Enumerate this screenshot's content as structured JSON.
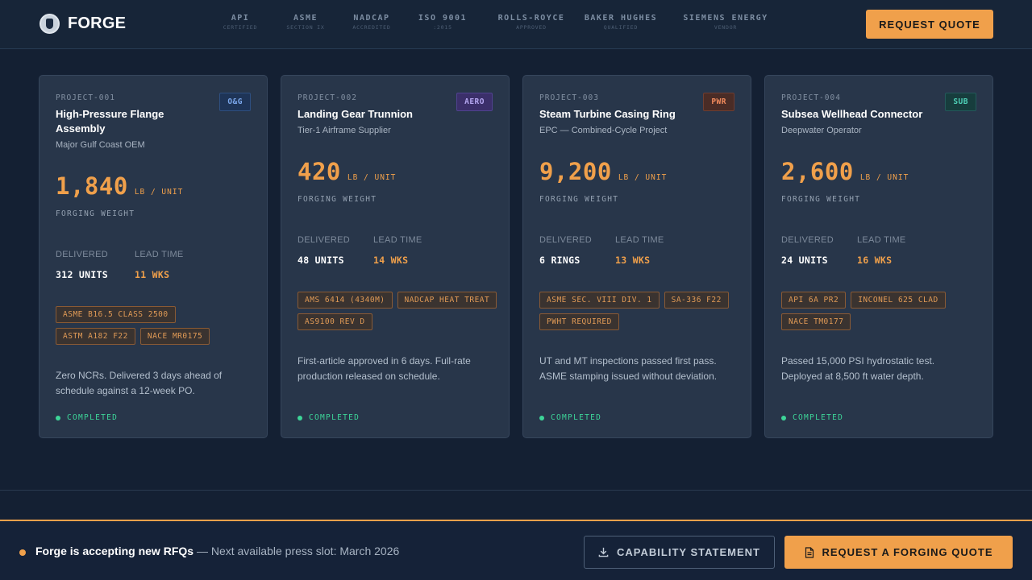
{
  "header": {
    "brand": "FORGE",
    "certifications": [
      {
        "name": "API",
        "sub": "CERTIFIED"
      },
      {
        "name": "ASME",
        "sub": "SECTION IX"
      },
      {
        "name": "NADCAP",
        "sub": "ACCREDITED"
      },
      {
        "name": "ISO 9001",
        "sub": ":2015"
      },
      {
        "name": "ROLLS-ROYCE",
        "sub": "APPROVED"
      },
      {
        "name": "BAKER HUGHES",
        "sub": "QUALIFIED"
      },
      {
        "name": "SIEMENS ENERGY",
        "sub": "VENDOR"
      }
    ],
    "quote_button": "REQUEST QUOTE"
  },
  "projects": [
    {
      "id": "PROJECT-001",
      "tag": "O&G",
      "title": "High-Pressure Flange Assembly",
      "client": "Major Gulf Coast OEM",
      "weight": "1,840",
      "weight_unit": "LB / UNIT",
      "weight_label": "FORGING WEIGHT",
      "delivered_label": "DELIVERED",
      "delivered": "312 UNITS",
      "lead_label": "LEAD TIME",
      "lead_time": "11 WKS",
      "specs": [
        "ASME B16.5 CLASS 2500",
        "ASTM A182 F22",
        "NACE MR0175"
      ],
      "note": "Zero NCRs. Delivered 3 days ahead of schedule against a 12-week PO.",
      "status": "COMPLETED"
    },
    {
      "id": "PROJECT-002",
      "tag": "AERO",
      "title": "Landing Gear Trunnion",
      "client": "Tier-1 Airframe Supplier",
      "weight": "420",
      "weight_unit": "LB / UNIT",
      "weight_label": "FORGING WEIGHT",
      "delivered_label": "DELIVERED",
      "delivered": "48 UNITS",
      "lead_label": "LEAD TIME",
      "lead_time": "14 WKS",
      "specs": [
        "AMS 6414 (4340M)",
        "NADCAP HEAT TREAT",
        "AS9100 REV D"
      ],
      "note": "First-article approved in 6 days. Full-rate production released on schedule.",
      "status": "COMPLETED"
    },
    {
      "id": "PROJECT-003",
      "tag": "PWR",
      "title": "Steam Turbine Casing Ring",
      "client": "EPC — Combined-Cycle Project",
      "weight": "9,200",
      "weight_unit": "LB / UNIT",
      "weight_label": "FORGING WEIGHT",
      "delivered_label": "DELIVERED",
      "delivered": "6 RINGS",
      "lead_label": "LEAD TIME",
      "lead_time": "13 WKS",
      "specs": [
        "ASME SEC. VIII DIV. 1",
        "SA-336 F22",
        "PWHT REQUIRED"
      ],
      "note": "UT and MT inspections passed first pass. ASME stamping issued without deviation.",
      "status": "COMPLETED"
    },
    {
      "id": "PROJECT-004",
      "tag": "SUB",
      "title": "Subsea Wellhead Connector",
      "client": "Deepwater Operator",
      "weight": "2,600",
      "weight_unit": "LB / UNIT",
      "weight_label": "FORGING WEIGHT",
      "delivered_label": "DELIVERED",
      "delivered": "24 UNITS",
      "lead_label": "LEAD TIME",
      "lead_time": "16 WKS",
      "specs": [
        "API 6A PR2",
        "INCONEL 625 CLAD",
        "NACE TM0177"
      ],
      "note": "Passed 15,000 PSI hydrostatic test. Deployed at 8,500 ft water depth.",
      "status": "COMPLETED"
    }
  ],
  "footer": {
    "message_strong": "Forge is accepting new RFQs",
    "message_sub": "— Next available press slot: March 2026",
    "capability_button": "CAPABILITY STATEMENT",
    "rfq_button": "REQUEST A FORGING QUOTE"
  },
  "colors": {
    "accent": "#f0a04b",
    "background": "#142033",
    "card": "#28364a",
    "status_green": "#3dd598"
  },
  "icons": {
    "brand": "forge-logo-icon",
    "capability": "download-icon",
    "rfq": "document-icon",
    "status": "status-dot-icon"
  }
}
